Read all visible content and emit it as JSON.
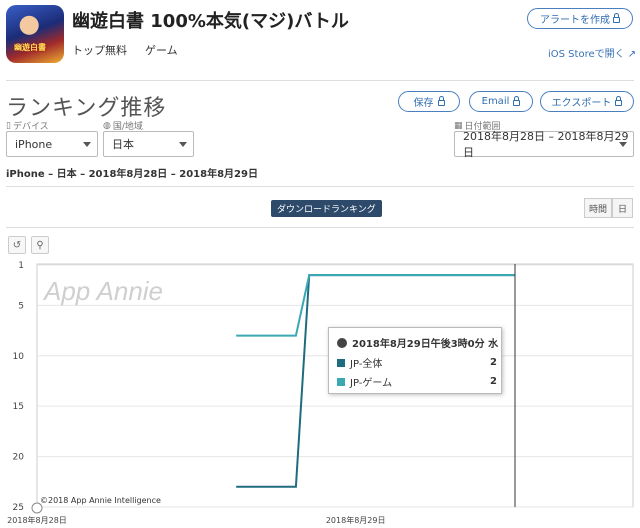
{
  "app": {
    "title": "幽遊白書 100%本気(マジ)バトル",
    "publisher_link": "トップ無料",
    "category": "ゲーム",
    "alert_button": "アラートを作成",
    "store_link": "iOS Storeで開く",
    "icon": "app-icon-yuyu-hakusho"
  },
  "section": {
    "title": "ランキング推移",
    "buttons": {
      "save": "保存",
      "email": "Email",
      "export": "エクスポート"
    }
  },
  "filters": {
    "device_label": "デバイス",
    "device_value": "iPhone",
    "country_label": "国/地域",
    "country_value": "日本",
    "date_label": "日付範囲",
    "date_value": "2018年8月28日 – 2018年8月29日"
  },
  "breadcrumb": "iPhone – 日本 – 2018年8月28日 – 2018年8月29日",
  "chart_controls": {
    "metric_button": "ダウンロードランキング",
    "granularity": [
      "時間",
      "日"
    ],
    "tools": [
      "reset-icon",
      "zoom-icon"
    ]
  },
  "chart_data": {
    "type": "line",
    "watermark": "App Annie",
    "credit": "©2018 App Annie Intelligence",
    "y_axis": {
      "reversed": true,
      "ylim": [
        1,
        25
      ],
      "ticks": [
        1,
        5,
        10,
        15,
        20,
        25
      ]
    },
    "x_ticks": [
      "2018年8月28日",
      "2018年8月29日"
    ],
    "x_range_hours": [
      0,
      36
    ],
    "grid": true,
    "series": [
      {
        "name": "JP-全体",
        "color": "#1f6b80",
        "points": [
          [
            15,
            23
          ],
          [
            19.5,
            23
          ],
          [
            20.5,
            2
          ],
          [
            36,
            2
          ]
        ]
      },
      {
        "name": "JP-ゲーム",
        "color": "#3aa9b3",
        "points": [
          [
            15,
            8
          ],
          [
            19.5,
            8
          ],
          [
            20.5,
            2
          ],
          [
            36,
            2
          ]
        ]
      }
    ],
    "crosshair_hour": 36
  },
  "tooltip": {
    "title": "2018年8月29日午後3時0分 水",
    "rows": [
      {
        "label": "JP-全体",
        "value": "2",
        "color": "#1f6b80"
      },
      {
        "label": "JP-ゲーム",
        "value": "2",
        "color": "#3aa9b3"
      }
    ]
  }
}
